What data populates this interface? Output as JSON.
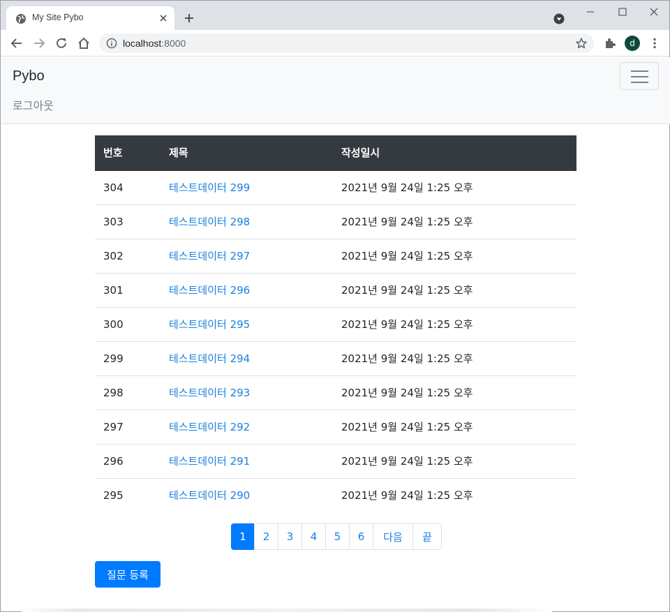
{
  "browser": {
    "tab_title": "My Site Pybo",
    "url_host": "localhost",
    "url_port": ":8000",
    "profile_initial": "d"
  },
  "navbar": {
    "brand": "Pybo",
    "logout": "로그아웃"
  },
  "table": {
    "headers": [
      "번호",
      "제목",
      "작성일시"
    ],
    "rows": [
      {
        "num": "304",
        "title": "테스트데이터 299",
        "date": "2021년 9월 24일 1:25 오후"
      },
      {
        "num": "303",
        "title": "테스트데이터 298",
        "date": "2021년 9월 24일 1:25 오후"
      },
      {
        "num": "302",
        "title": "테스트데이터 297",
        "date": "2021년 9월 24일 1:25 오후"
      },
      {
        "num": "301",
        "title": "테스트데이터 296",
        "date": "2021년 9월 24일 1:25 오후"
      },
      {
        "num": "300",
        "title": "테스트데이터 295",
        "date": "2021년 9월 24일 1:25 오후"
      },
      {
        "num": "299",
        "title": "테스트데이터 294",
        "date": "2021년 9월 24일 1:25 오후"
      },
      {
        "num": "298",
        "title": "테스트데이터 293",
        "date": "2021년 9월 24일 1:25 오후"
      },
      {
        "num": "297",
        "title": "테스트데이터 292",
        "date": "2021년 9월 24일 1:25 오후"
      },
      {
        "num": "296",
        "title": "테스트데이터 291",
        "date": "2021년 9월 24일 1:25 오후"
      },
      {
        "num": "295",
        "title": "테스트데이터 290",
        "date": "2021년 9월 24일 1:25 오후"
      }
    ]
  },
  "pagination": {
    "items": [
      {
        "label": "1",
        "active": true
      },
      {
        "label": "2",
        "active": false
      },
      {
        "label": "3",
        "active": false
      },
      {
        "label": "4",
        "active": false
      },
      {
        "label": "5",
        "active": false
      },
      {
        "label": "6",
        "active": false
      },
      {
        "label": "다음",
        "active": false
      },
      {
        "label": "끝",
        "active": false
      }
    ]
  },
  "actions": {
    "register_question": "질문 등록"
  },
  "colors": {
    "primary": "#007bff",
    "link": "#1a7fe0",
    "table_header": "#343a40",
    "navbar_bg": "#f8f9fa"
  }
}
